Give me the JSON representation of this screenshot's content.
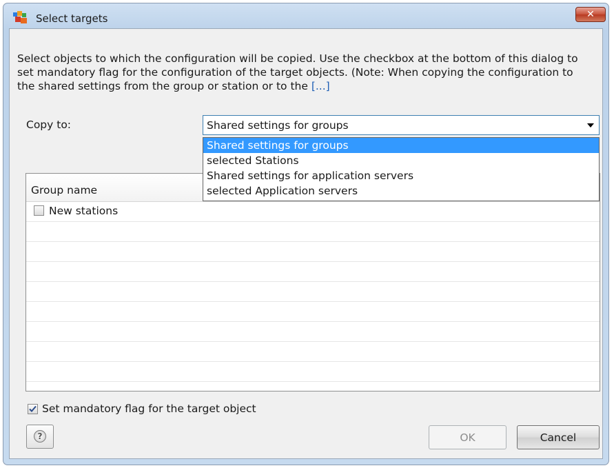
{
  "window": {
    "title": "Select targets",
    "close_label": "✕"
  },
  "description": {
    "text": "Select objects to which the configuration will be copied. Use the checkbox at the bottom of this dialog to set mandatory flag for the configuration of the target objects. (Note: When copying the configuration to the shared settings from the group or station or to the ",
    "more_link": "[...]"
  },
  "copy_to": {
    "label": "Copy to:",
    "selected": "Shared settings for groups",
    "options": [
      "Shared settings for groups",
      "selected Stations",
      "Shared settings for application servers",
      "selected Application servers"
    ]
  },
  "grid": {
    "column_header": "Group name",
    "rows": [
      {
        "label": "New stations",
        "checked": false
      }
    ]
  },
  "mandatory_flag": {
    "label": "Set mandatory flag for the target object",
    "checked": true
  },
  "buttons": {
    "help": "?",
    "ok": "OK",
    "cancel": "Cancel"
  },
  "colors": {
    "selection": "#3399ff",
    "link": "#1f5fb5",
    "close_button": "#c8523a"
  }
}
